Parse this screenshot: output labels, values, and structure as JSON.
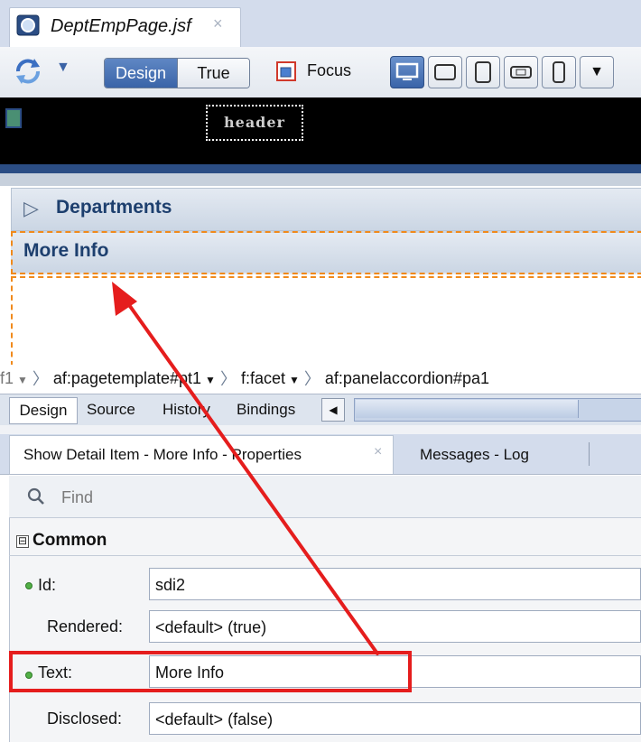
{
  "editor": {
    "tab_title": "DeptEmpPage.jsf",
    "tab_close": "×"
  },
  "toolbar": {
    "refresh_dropdown": "▼",
    "design_label": "Design",
    "true_label": "True",
    "focus_label": "Focus",
    "devices": [
      "desktop-icon",
      "tablet-landscape-icon",
      "tablet-portrait-icon",
      "phone-landscape-icon",
      "phone-portrait-icon",
      "dropdown-icon"
    ]
  },
  "canvas": {
    "header_facet": "header",
    "departments_label": "Departments",
    "more_info_label": "More Info"
  },
  "breadcrumb": {
    "items": [
      "f1",
      "af:pagetemplate#pt1",
      "f:facet",
      "af:panelaccordion#pa1"
    ],
    "dropdown": "▼",
    "separator": "〉"
  },
  "editor_tabs": [
    "Design",
    "Source",
    "History",
    "Bindings"
  ],
  "scroll_left": "◀",
  "panel_tabs": {
    "properties": "Show Detail Item - More Info - Properties",
    "close": "×",
    "log": "Messages - Log"
  },
  "find": {
    "placeholder": "Find"
  },
  "properties": {
    "section_toggle": "⊟",
    "section": "Common",
    "id_label": "Id:",
    "id_value": "sdi2",
    "rendered_label": "Rendered:",
    "rendered_value": "<default> (true)",
    "text_label": "Text:",
    "text_value": "More Info",
    "disclosed_label": "Disclosed:",
    "disclosed_value": "<default> (false)"
  },
  "colors": {
    "annotation_red": "#e51d1d",
    "selection_orange": "#f08a1c",
    "accent_blue": "#3a64a8",
    "required_dot_green": "#52b046"
  }
}
